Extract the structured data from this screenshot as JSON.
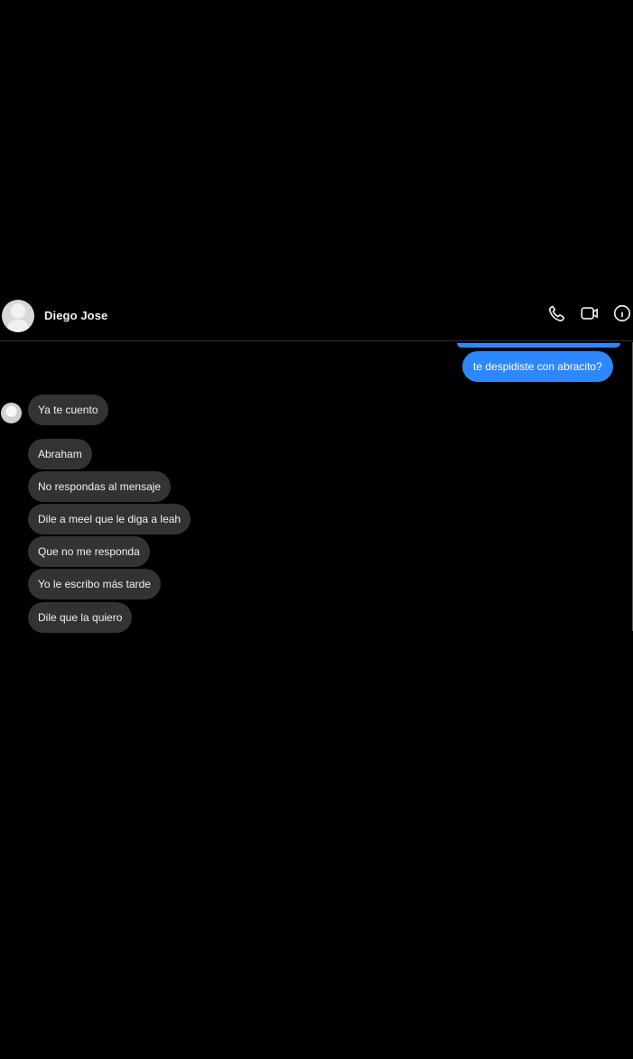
{
  "header": {
    "contact_name": "Diego Jose",
    "icons": [
      "phone-icon",
      "video-camera-icon",
      "info-icon"
    ]
  },
  "thread": {
    "sent_messages": [
      {
        "text": "te despidiste con abracito?"
      }
    ],
    "received_messages": [
      {
        "text": "Ya te cuento"
      },
      {
        "text": "Abraham"
      },
      {
        "text": "No respondas al mensaje"
      },
      {
        "text": "Dile a meel que le diga a leah"
      },
      {
        "text": "Que no me responda"
      },
      {
        "text": "Yo le escribo más tarde"
      },
      {
        "text": "Dile que la quiero"
      }
    ]
  },
  "colors": {
    "background": "#000000",
    "sent_bubble": "#2d88ff",
    "received_bubble": "#323335",
    "text": "#f1f1f1"
  }
}
